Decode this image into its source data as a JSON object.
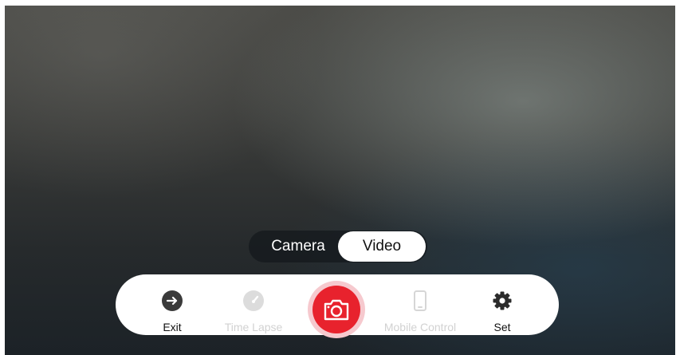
{
  "mode_toggle": {
    "camera_label": "Camera",
    "video_label": "Video",
    "selected": "Video"
  },
  "controls": {
    "exit_label": "Exit",
    "time_lapse_label": "Time Lapse",
    "mobile_control_label": "Mobile Control",
    "set_label": "Set"
  },
  "icons": {
    "exit": "arrow-right-circle-icon",
    "time_lapse": "gauge-icon",
    "shutter": "camera-icon",
    "mobile_control": "phone-icon",
    "set": "gear-icon"
  },
  "colors": {
    "shutter": "#e8222d",
    "shutter_ring": "#f6c9ce",
    "disabled_text": "#d2d2d2"
  }
}
